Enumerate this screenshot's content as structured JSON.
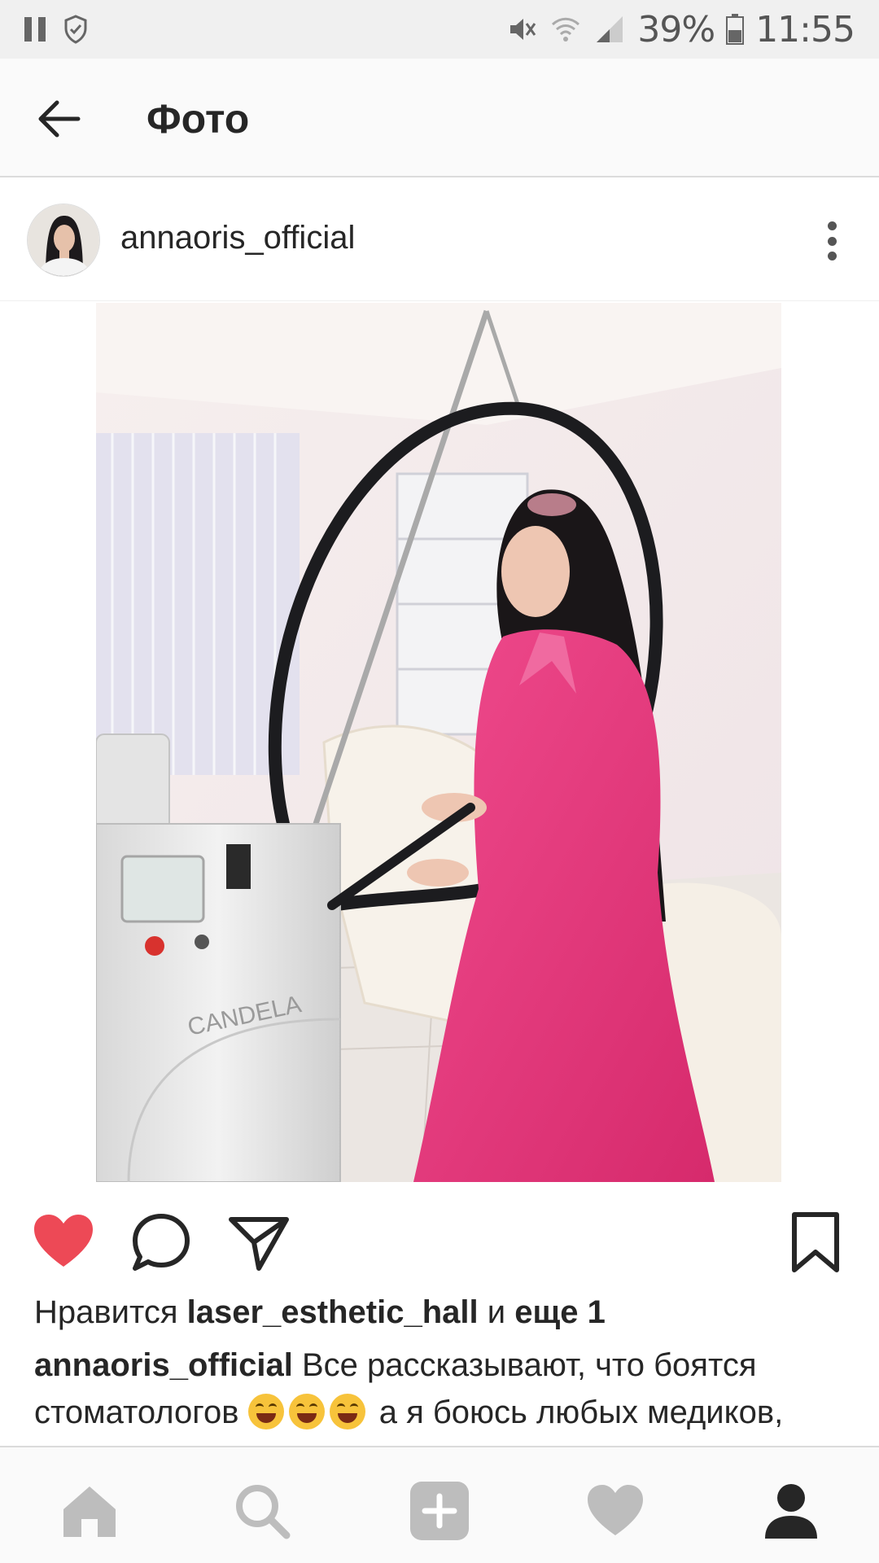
{
  "status_bar": {
    "battery": "39%",
    "time": "11:55"
  },
  "header": {
    "title": "Фото"
  },
  "post": {
    "username": "annaoris_official",
    "liked": true,
    "likes_prefix": "Нравится",
    "likes_user": "laser_esthetic_hall",
    "likes_and": "и",
    "likes_more": "еще 1",
    "caption_user": "annaoris_official",
    "caption_text_1": "Все рассказывают, что боятся стоматологов",
    "caption_text_2": "а я боюсь любых медиков,",
    "photo_brand": "CANDELA"
  },
  "colors": {
    "like_red": "#ed4956",
    "dress_pink": "#e8337a",
    "nav_inactive": "#bdbdbd",
    "nav_active": "#262626"
  }
}
